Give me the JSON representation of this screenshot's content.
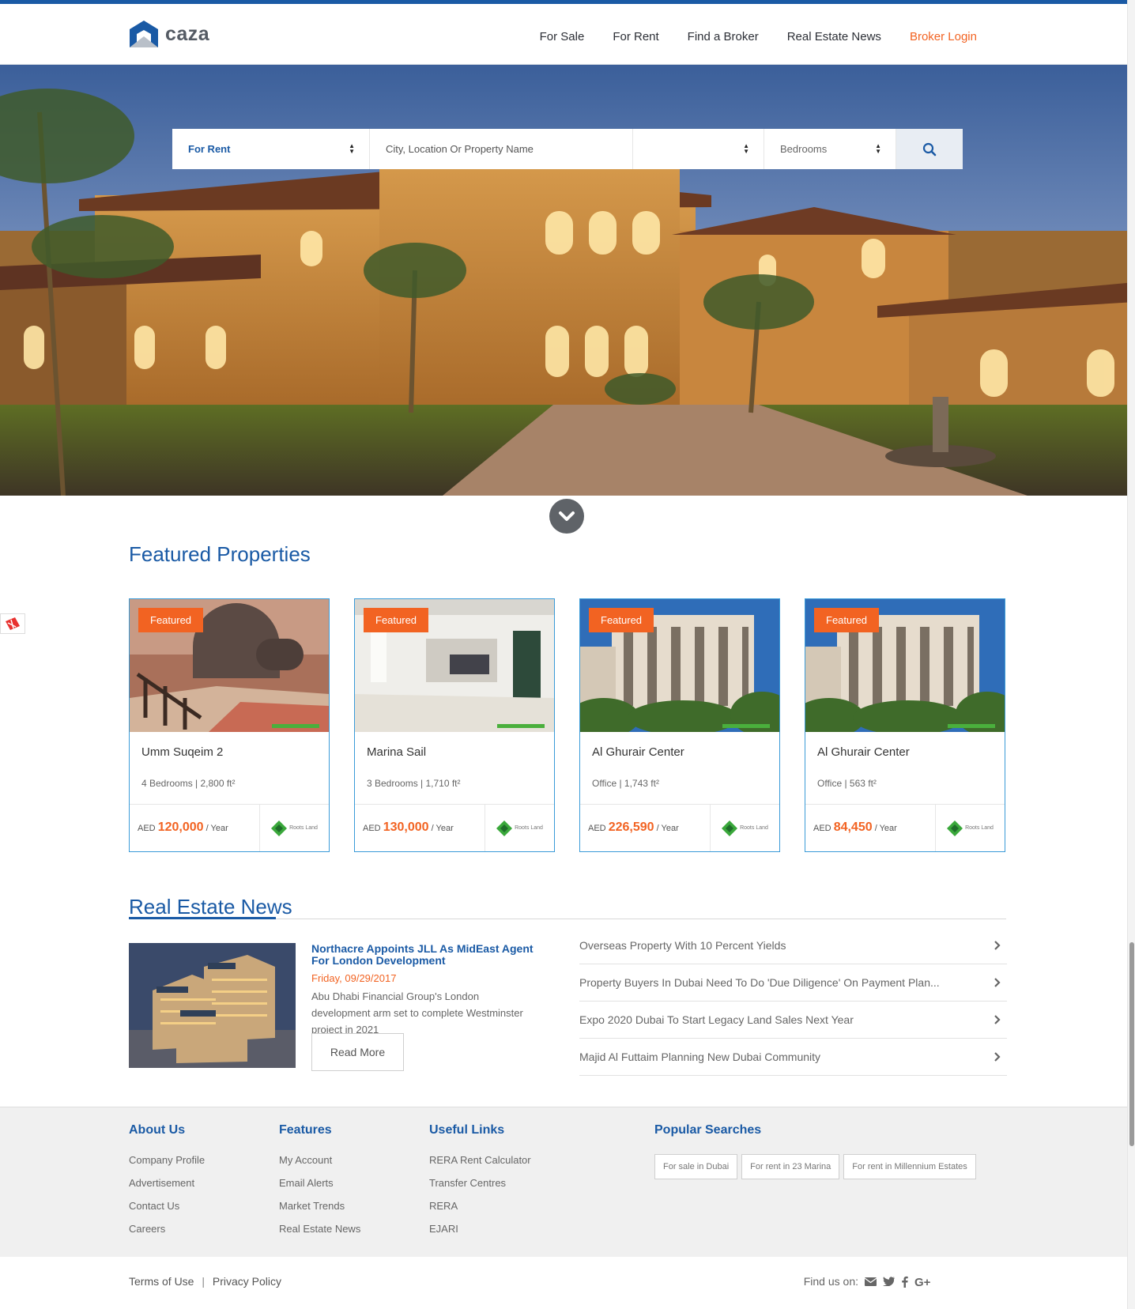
{
  "brand": {
    "name": "caza"
  },
  "nav": {
    "for_sale": "For Sale",
    "for_rent": "For Rent",
    "find_broker": "Find a Broker",
    "news": "Real Estate News",
    "broker_login": "Broker Login"
  },
  "search": {
    "type_value": "For Rent",
    "location_placeholder": "City, Location Or Property Name",
    "price_value": "",
    "bedrooms_value": "Bedrooms",
    "search_icon": "search-icon"
  },
  "featured": {
    "title": "Featured Properties",
    "cards": [
      {
        "badge": "Featured",
        "title": "Umm Suqeim 2",
        "meta": "4 Bedrooms | 2,800 ft²",
        "currency": "AED",
        "price": "120,000",
        "period": "/ Year",
        "agency": "Roots Land"
      },
      {
        "badge": "Featured",
        "title": "Marina Sail",
        "meta": "3 Bedrooms | 1,710 ft²",
        "currency": "AED",
        "price": "130,000",
        "period": "/ Year",
        "agency": "Roots Land"
      },
      {
        "badge": "Featured",
        "title": "Al Ghurair Center",
        "meta": "Office | 1,743 ft²",
        "currency": "AED",
        "price": "226,590",
        "period": "/ Year",
        "agency": "Roots Land"
      },
      {
        "badge": "Featured",
        "title": "Al Ghurair Center",
        "meta": "Office | 563 ft²",
        "currency": "AED",
        "price": "84,450",
        "period": "/ Year",
        "agency": "Roots Land"
      }
    ]
  },
  "news": {
    "title": "Real Estate News",
    "main": {
      "headline": "Northacre Appoints JLL As MidEast Agent For London Development",
      "date": "Friday, 09/29/2017",
      "summary": "Abu Dhabi Financial Group's London development arm set to complete Westminster project in 2021",
      "read_more": "Read More"
    },
    "list": [
      "Overseas Property With 10 Percent Yields",
      "Property Buyers In Dubai Need To Do 'Due Diligence' On Payment Plan...",
      "Expo 2020 Dubai To Start Legacy Land Sales Next Year",
      "Majid Al Futtaim Planning New Dubai Community"
    ]
  },
  "footer": {
    "about": {
      "title": "About Us",
      "links": [
        "Company Profile",
        "Advertisement",
        "Contact Us",
        "Careers"
      ]
    },
    "features": {
      "title": "Features",
      "links": [
        "My Account",
        "Email Alerts",
        "Market Trends",
        "Real Estate News"
      ]
    },
    "useful": {
      "title": "Useful Links",
      "links": [
        "RERA Rent Calculator",
        "Transfer Centres",
        "RERA",
        "EJARI"
      ]
    },
    "popular": {
      "title": "Popular Searches",
      "tags": [
        "For sale in Dubai",
        "For rent in 23 Marina",
        "For rent in Millennium Estates"
      ]
    },
    "terms": "Terms of Use",
    "separator": "|",
    "privacy": "Privacy Policy",
    "find_us": "Find us on:"
  },
  "colors": {
    "brand_blue": "#1a5aa5",
    "accent_orange": "#f26322",
    "card_border": "#3a9bd8"
  }
}
